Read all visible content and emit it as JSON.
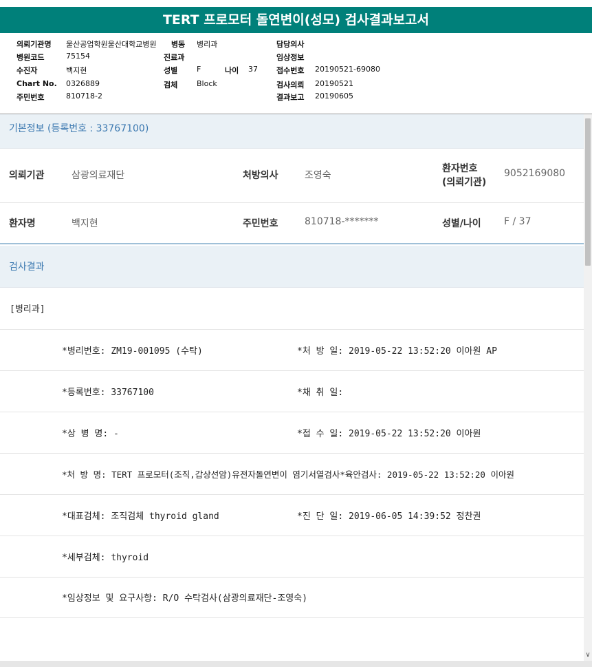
{
  "title": "TERT 프로모터 돌연변이(성모) 검사결과보고서",
  "report_header": {
    "row1": {
      "k1": "의뢰기관명",
      "v1": "울산공업학원울산대학교병원",
      "k2": "병동",
      "v2": "병리과",
      "k3": "담당의사",
      "v3": ""
    },
    "row2": {
      "k1": "병원코드",
      "v1": "75154",
      "k2": "진료과",
      "v2": "",
      "k3": "임상정보",
      "v3": ""
    },
    "row3": {
      "k1": "수진자",
      "v1": "백지현",
      "k2": "성별",
      "v2": "F",
      "k2b": "나이",
      "v2b": "37",
      "k3": "접수번호",
      "v3": "20190521-69080"
    },
    "row4": {
      "k1": "Chart No.",
      "v1": "0326889",
      "k2": "검체",
      "v2": "Block",
      "k3": "검사의뢰",
      "v3": "20190521"
    },
    "row5": {
      "k1": "주민번호",
      "v1": "810718-2",
      "k3": "결과보고",
      "v3": "20190605"
    }
  },
  "basic_info": {
    "heading": "기본정보",
    "sub": "(등록번호 : 33767100)",
    "institution_label": "의뢰기관",
    "institution_value": "삼광의료재단",
    "doctor_label": "처방의사",
    "doctor_value": "조영숙",
    "patient_no_label_1": "환자번호",
    "patient_no_label_2": "(의뢰기관)",
    "patient_no_value": "9052169080",
    "patient_name_label": "환자명",
    "patient_name_value": "백지현",
    "rrn_label": "주민번호",
    "rrn_value": "810718-*******",
    "sex_age_label": "성별/나이",
    "sex_age_value": "F / 37"
  },
  "results": {
    "heading": "검사결과",
    "department": "[병리과]",
    "rows": [
      {
        "left": "*병리번호: ZM19-001095 (수탁)",
        "right": "*처 방 일: 2019-05-22 13:52:20  이아원 AP"
      },
      {
        "left": "*등록번호: 33767100",
        "right": "*채 취 일:"
      },
      {
        "left": "*상 병 명: -",
        "right": "*접 수 일: 2019-05-22 13:52:20  이아원"
      },
      {
        "left": "*처 방 명: TERT 프로모터(조직,갑상선암)유전자돌연변이 염기서열검사*육안검사: 2019-05-22 13:52:20  이아원",
        "right": ""
      },
      {
        "left": "*대표검체: 조직검체 thyroid gland",
        "right": "*진 단 일: 2019-06-05 14:39:52  정찬권"
      },
      {
        "left": "*세부검체: thyroid",
        "right": ""
      },
      {
        "left": "*임상정보 및 요구사항: R/O 수탁검사(삼광의료재단-조영숙)",
        "right": ""
      }
    ]
  },
  "colors": {
    "title_bg": "#00807a",
    "section_bg": "#eaf1f6",
    "section_text": "#3b78b0"
  },
  "icons": {
    "scroll_down": "chevron-down-icon"
  }
}
